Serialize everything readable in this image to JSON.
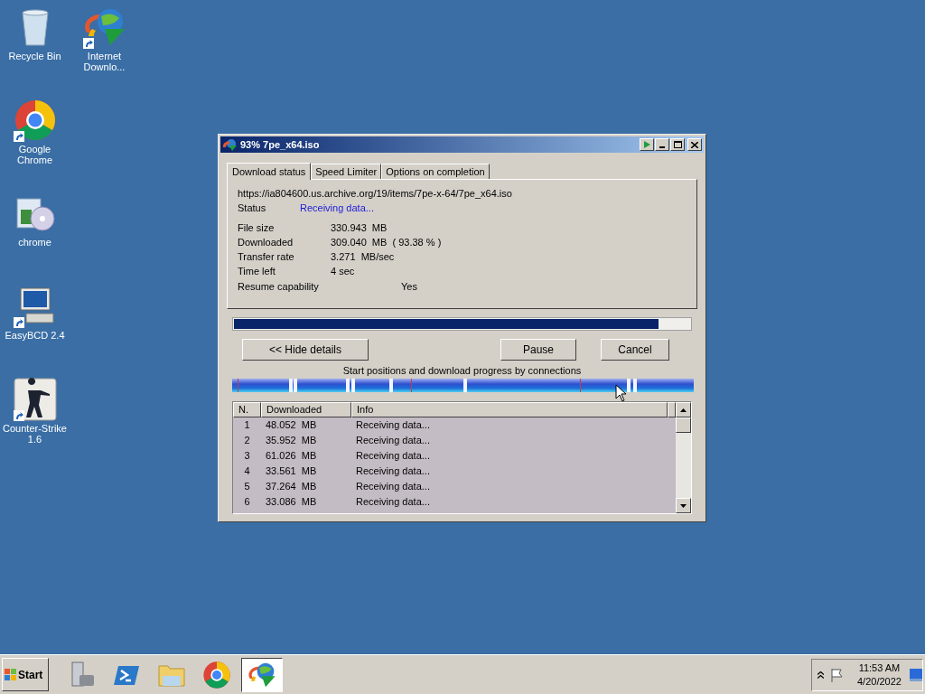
{
  "desktop_columns": [
    [
      {
        "label": "Recycle Bin",
        "kind": "recycle",
        "shortcut": false
      },
      {
        "label": "Google Chrome",
        "kind": "chrome",
        "shortcut": true
      },
      {
        "label": "chrome",
        "kind": "installer",
        "shortcut": false
      },
      {
        "label": "EasyBCD 2.4",
        "kind": "computer",
        "shortcut": true
      },
      {
        "label": "Counter-Strike 1.6",
        "kind": "soldier",
        "shortcut": true
      }
    ],
    [
      {
        "label": "Internet Downlo...",
        "kind": "globe",
        "shortcut": true
      }
    ]
  ],
  "window": {
    "title": "93% 7pe_x64.iso",
    "tabs": [
      {
        "label": "Download status",
        "selected": true
      },
      {
        "label": "Speed Limiter",
        "selected": false
      },
      {
        "label": "Options on completion",
        "selected": false
      }
    ],
    "url": "https://ia804600.us.archive.org/19/items/7pe-x-64/7pe_x64.iso",
    "status": {
      "label": "Status",
      "value": "Receiving data..."
    },
    "fields": [
      {
        "label": "File size",
        "value": "330.943  MB"
      },
      {
        "label": "Downloaded",
        "value": "309.040  MB  ( 93.38 % )"
      },
      {
        "label": "Transfer rate",
        "value": "3.271  MB/sec"
      },
      {
        "label": "Time left",
        "value": "4 sec"
      }
    ],
    "resume": {
      "label": "Resume capability",
      "value": "Yes"
    },
    "progress": {
      "level": 0.93
    },
    "hide_button": "<< Hide details",
    "pause_button": "Pause",
    "cancel_button": "Cancel",
    "connections_caption": "Start positions and download progress by connections",
    "table": {
      "columns": [
        "N.",
        "Downloaded",
        "Info"
      ],
      "rows": [
        [
          "1",
          "48.052  MB",
          "Receiving data..."
        ],
        [
          "2",
          "35.952  MB",
          "Receiving data..."
        ],
        [
          "3",
          "61.026  MB",
          "Receiving data..."
        ],
        [
          "4",
          "33.561  MB",
          "Receiving data..."
        ],
        [
          "5",
          "37.264  MB",
          "Receiving data..."
        ],
        [
          "6",
          "33.086  MB",
          "Receiving data..."
        ]
      ]
    }
  },
  "taskbar": {
    "start": "Start",
    "apps": [
      {
        "kind": "server",
        "selected": false
      },
      {
        "kind": "shell",
        "selected": false
      },
      {
        "kind": "folder",
        "selected": false
      },
      {
        "kind": "chrome",
        "selected": false
      },
      {
        "kind": "globe",
        "selected": true
      }
    ],
    "time": "11:53 AM",
    "date": "4/20/2022"
  }
}
